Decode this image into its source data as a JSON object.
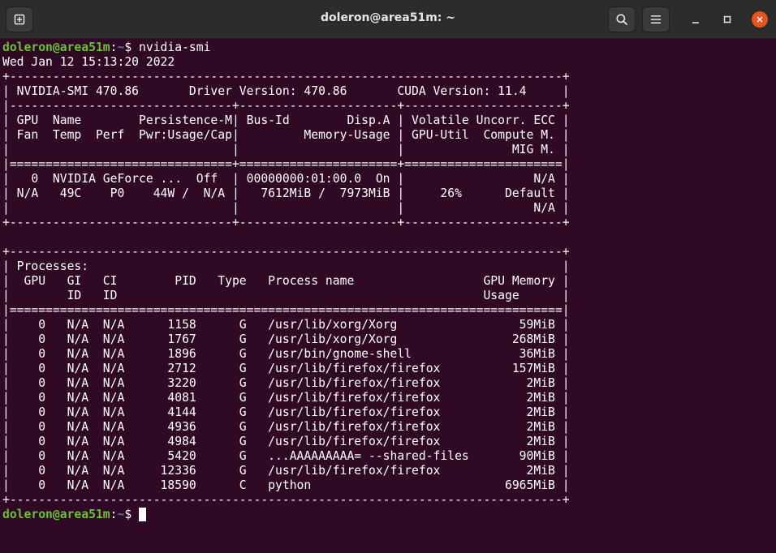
{
  "window": {
    "title": "doleron@area51m: ~"
  },
  "terminal": {
    "prompt_user": "doleron@area51m",
    "prompt_sep": ":",
    "prompt_path": "~",
    "prompt_symbol": "$ ",
    "command": "nvidia-smi",
    "lines": [
      "Wed Jan 12 15:13:20 2022",
      "+-----------------------------------------------------------------------------+",
      "| NVIDIA-SMI 470.86       Driver Version: 470.86       CUDA Version: 11.4     |",
      "|-------------------------------+----------------------+----------------------+",
      "| GPU  Name        Persistence-M| Bus-Id        Disp.A | Volatile Uncorr. ECC |",
      "| Fan  Temp  Perf  Pwr:Usage/Cap|         Memory-Usage | GPU-Util  Compute M. |",
      "|                               |                      |               MIG M. |",
      "|===============================+======================+======================|",
      "|   0  NVIDIA GeForce ...  Off  | 00000000:01:00.0  On |                  N/A |",
      "| N/A   49C    P0    44W /  N/A |   7612MiB /  7973MiB |     26%      Default |",
      "|                               |                      |                  N/A |",
      "+-------------------------------+----------------------+----------------------+",
      "",
      "+-----------------------------------------------------------------------------+",
      "| Processes:                                                                  |",
      "|  GPU   GI   CI        PID   Type   Process name                  GPU Memory |",
      "|        ID   ID                                                   Usage      |",
      "|=============================================================================|",
      "|    0   N/A  N/A      1158      G   /usr/lib/xorg/Xorg                 59MiB |",
      "|    0   N/A  N/A      1767      G   /usr/lib/xorg/Xorg                268MiB |",
      "|    0   N/A  N/A      1896      G   /usr/bin/gnome-shell               36MiB |",
      "|    0   N/A  N/A      2712      G   /usr/lib/firefox/firefox          157MiB |",
      "|    0   N/A  N/A      3220      G   /usr/lib/firefox/firefox            2MiB |",
      "|    0   N/A  N/A      4081      G   /usr/lib/firefox/firefox            2MiB |",
      "|    0   N/A  N/A      4144      G   /usr/lib/firefox/firefox            2MiB |",
      "|    0   N/A  N/A      4936      G   /usr/lib/firefox/firefox            2MiB |",
      "|    0   N/A  N/A      4984      G   /usr/lib/firefox/firefox            2MiB |",
      "|    0   N/A  N/A      5420      G   ...AAAAAAAAA= --shared-files       90MiB |",
      "|    0   N/A  N/A     12336      G   /usr/lib/firefox/firefox            2MiB |",
      "|    0   N/A  N/A     18590      C   python                           6965MiB |",
      "+-----------------------------------------------------------------------------+"
    ]
  },
  "icons": {
    "new_tab": "new-tab-icon",
    "search": "search-icon",
    "menu": "hamburger-menu-icon",
    "minimize": "minimize-icon",
    "maximize": "maximize-icon",
    "close": "close-icon"
  },
  "colors": {
    "background": "#300a24",
    "prompt_user": "#6ac138",
    "prompt_path": "#3d7ac7",
    "close_button": "#e95420"
  }
}
